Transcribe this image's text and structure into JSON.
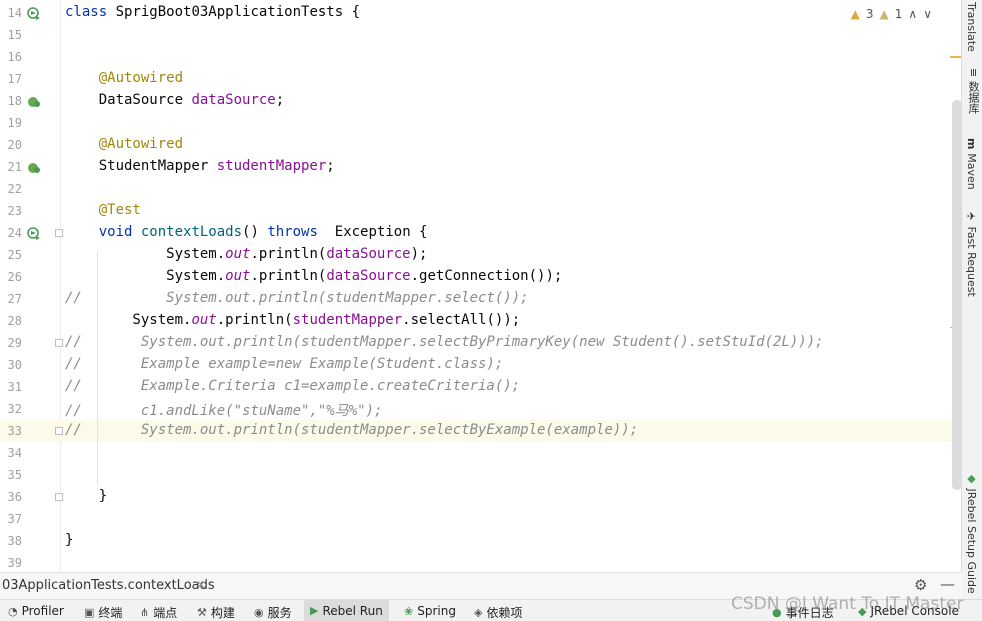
{
  "editor": {
    "lines": [
      {
        "n": "14",
        "html": "<span class=\"kw\">class</span> SprigBoot03ApplicationTests {"
      },
      {
        "n": "15",
        "html": ""
      },
      {
        "n": "16",
        "html": ""
      },
      {
        "n": "17",
        "html": "    <span class=\"ann\">@Autowired</span>"
      },
      {
        "n": "18",
        "html": "    DataSource <span class=\"fld\">dataSource</span>;"
      },
      {
        "n": "19",
        "html": ""
      },
      {
        "n": "20",
        "html": "    <span class=\"ann\">@Autowired</span>"
      },
      {
        "n": "21",
        "html": "    StudentMapper <span class=\"fld\">studentMapper</span>;"
      },
      {
        "n": "22",
        "html": ""
      },
      {
        "n": "23",
        "html": "    <span class=\"ann\">@Test</span>"
      },
      {
        "n": "24",
        "html": "    <span class=\"kw\">void</span> <span style=\"color:#00627a\">contextLoads</span>() <span class=\"kw\">throws</span>  Exception {"
      },
      {
        "n": "25",
        "html": "            System.<span class=\"ital\">out</span>.println(<span class=\"fld\">dataSource</span>);"
      },
      {
        "n": "26",
        "html": "            System.<span class=\"ital\">out</span>.println(<span class=\"fld\">dataSource</span>.getConnection());"
      },
      {
        "n": "27",
        "html": "<span class=\"cmt\">//          System.out.println(studentMapper.select());</span>"
      },
      {
        "n": "28",
        "html": "        System.<span class=\"ital\">out</span>.println(<span class=\"fld\">studentMapper</span>.selectAll());"
      },
      {
        "n": "29",
        "html": "<span class=\"cmt\">//       System.out.println(studentMapper.selectByPrimaryKey(new Student().setStuId(2L)));</span>"
      },
      {
        "n": "30",
        "html": "<span class=\"cmt\">//       Example example=new Example(Student.class);</span>"
      },
      {
        "n": "31",
        "html": "<span class=\"cmt\">//       Example.Criteria c1=example.createCriteria();</span>"
      },
      {
        "n": "32",
        "html": "<span class=\"cmt\">//       c1.andLike(\"stuName\",\"%马%\");</span>"
      },
      {
        "n": "33",
        "html": "<span class=\"cmt\">//       System.out.println(studentMapper.selectByExample(example));</span>"
      },
      {
        "n": "34",
        "html": ""
      },
      {
        "n": "35",
        "html": ""
      },
      {
        "n": "36",
        "html": "    }"
      },
      {
        "n": "37",
        "html": ""
      },
      {
        "n": "38",
        "html": "}"
      },
      {
        "n": "39",
        "html": ""
      }
    ],
    "inspections": {
      "warnings": "3",
      "weak_warnings": "1"
    }
  },
  "right_sidebar": [
    "Translate",
    "数据库",
    "Maven",
    "Fast Request",
    "JRebel Setup Guide"
  ],
  "breadcrumb": "03ApplicationTests.contextLoads",
  "tool_windows": [
    "Profiler",
    "终端",
    "端点",
    "构建",
    "服务",
    "Rebel Run",
    "Spring",
    "依赖项"
  ],
  "status_right": [
    "事件日志",
    "JRebel Console"
  ],
  "watermark": "CSDN @I Want To IT Master",
  "colors": {
    "accent_run": "#4a9b56",
    "warning": "#e2a93a"
  }
}
